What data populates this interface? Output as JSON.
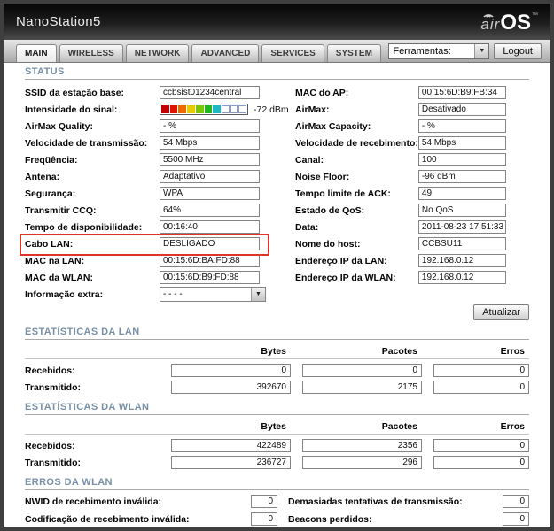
{
  "header": {
    "device_name": "NanoStation5",
    "brand_air": "air",
    "brand_os": "OS",
    "brand_tm": "™"
  },
  "tabbar": {
    "tabs": [
      "MAIN",
      "WIRELESS",
      "NETWORK",
      "ADVANCED",
      "SERVICES",
      "SYSTEM"
    ],
    "active_tab": "MAIN",
    "tools_select_value": "Ferramentas:",
    "logout_label": "Logout"
  },
  "status": {
    "title": "STATUS",
    "signal": {
      "segments": [
        "#c40000",
        "#dd1500",
        "#ee6a00",
        "#e8cc00",
        "#7cc800",
        "#1cb81c",
        "#1cb8c8"
      ],
      "empty_segments": 3,
      "empty_border_color": "#8a9ad0"
    },
    "left": [
      {
        "label": "SSID da estação base:",
        "value": "ccbsist01234central"
      },
      {
        "label": "Intensidade do sinal:",
        "value": "-72 dBm"
      },
      {
        "label": "AirMax Quality:",
        "value": "- %"
      },
      {
        "label": "Velocidade de transmissão:",
        "value": "54 Mbps"
      },
      {
        "label": "Freqüência:",
        "value": "5500 MHz"
      },
      {
        "label": "Antena:",
        "value": "Adaptativo"
      },
      {
        "label": "Segurança:",
        "value": "WPA"
      },
      {
        "label": "Transmitir CCQ:",
        "value": "64%"
      },
      {
        "label": "Tempo de disponibilidade:",
        "value": "00:16:40"
      },
      {
        "label": "Cabo LAN:",
        "value": "DESLIGADO"
      },
      {
        "label": "MAC na LAN:",
        "value": "00:15:6D:BA:FD:88"
      },
      {
        "label": "MAC da WLAN:",
        "value": "00:15:6D:B9:FD:88"
      },
      {
        "label": "Informação extra:",
        "value": "- - - -"
      }
    ],
    "right": [
      {
        "label": "MAC do AP:",
        "value": "00:15:6D:B9:FB:34"
      },
      {
        "label": "AirMax:",
        "value": "Desativado"
      },
      {
        "label": "AirMax Capacity:",
        "value": "- %"
      },
      {
        "label": "Velocidade de recebimento:",
        "value": "54 Mbps"
      },
      {
        "label": "Canal:",
        "value": "100"
      },
      {
        "label": "Noise Floor:",
        "value": "-96 dBm"
      },
      {
        "label": "Tempo limite de ACK:",
        "value": "49"
      },
      {
        "label": "Estado de QoS:",
        "value": "No QoS"
      },
      {
        "label": "Data:",
        "value": "2011-08-23 17:51:33"
      },
      {
        "label": "Nome do host:",
        "value": "CCBSU11"
      },
      {
        "label": "Endereço IP da LAN:",
        "value": "192.168.0.12"
      },
      {
        "label": "Endereço IP da WLAN:",
        "value": "192.168.0.12"
      }
    ],
    "refresh_button": "Atualizar"
  },
  "lan_stats": {
    "title": "ESTATÍSTICAS DA LAN",
    "columns": [
      "Bytes",
      "Pacotes",
      "Erros"
    ],
    "rows": [
      {
        "label": "Recebidos:",
        "values": [
          "0",
          "0",
          "0"
        ]
      },
      {
        "label": "Transmitido:",
        "values": [
          "392670",
          "2175",
          "0"
        ]
      }
    ]
  },
  "wlan_stats": {
    "title": "ESTATÍSTICAS DA WLAN",
    "columns": [
      "Bytes",
      "Pacotes",
      "Erros"
    ],
    "rows": [
      {
        "label": "Recebidos:",
        "values": [
          "422489",
          "2356",
          "0"
        ]
      },
      {
        "label": "Transmitido:",
        "values": [
          "236727",
          "296",
          "0"
        ]
      }
    ]
  },
  "wlan_errors": {
    "title": "ERROS DA WLAN",
    "items": [
      {
        "label": "NWID de recebimento inválida:",
        "value": "0"
      },
      {
        "label": "Demasiadas tentativas de transmissão:",
        "value": "0"
      },
      {
        "label": "Codificação de recebimento inválida:",
        "value": "0"
      },
      {
        "label": "Beacons perdidos:",
        "value": "0"
      }
    ]
  }
}
